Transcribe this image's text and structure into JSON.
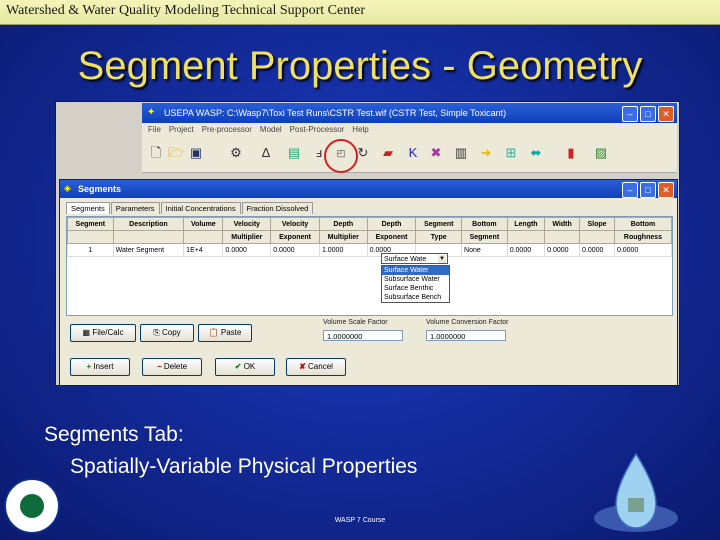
{
  "header": {
    "banner": "Watershed & Water Quality Modeling Technical Support Center"
  },
  "slide": {
    "title": "Segment Properties - Geometry",
    "caption_line1": "Segments Tab:",
    "caption_line2": "Spatially-Variable Physical Properties",
    "footer": "WASP 7 Course"
  },
  "app": {
    "window_title": "USEPA WASP: C:\\Wasp7\\Toxi Test Runs\\CSTR Test.wif (CSTR Test, Simple Toxicant)",
    "menu": [
      "File",
      "Project",
      "Pre-processor",
      "Model",
      "Post-Processor",
      "Help"
    ]
  },
  "dialog": {
    "title": "Segments",
    "tabs": [
      "Segments",
      "Parameters",
      "Initial Concentrations",
      "Fraction Dissolved"
    ],
    "columns_top": [
      "Segment",
      "Description",
      "Volume",
      "Velocity",
      "Velocity",
      "Depth",
      "Depth",
      "Segment",
      "Bottom",
      "Length",
      "Width",
      "Slope",
      "Bottom"
    ],
    "columns_bottom": [
      "",
      "",
      "",
      "Multiplier",
      "Exponent",
      "Multiplier",
      "Exponent",
      "Type",
      "Segment",
      "",
      "",
      "",
      "Roughness"
    ],
    "row": [
      "1",
      "Water Segment",
      "1E+4",
      "0.0000",
      "0.0000",
      "1.0000",
      "0.0000",
      "Surface Wate",
      "None",
      "0.0000",
      "0.0000",
      "0.0000",
      "0.0000"
    ],
    "type_options": [
      "Surface Water",
      "Subsurface Water",
      "Surface Benthic",
      "Subsurface Bench"
    ],
    "volume_scale_label": "Volume Scale Factor",
    "volume_scale_value": "1.0000000",
    "volume_conv_label": "Volume Conversion Factor",
    "volume_conv_value": "1.0000000",
    "buttons": {
      "filecalc": "File/Calc",
      "copy": "Copy",
      "paste": "Paste",
      "insert": "Insert",
      "delete": "Delete",
      "ok": "OK",
      "cancel": "Cancel"
    }
  }
}
